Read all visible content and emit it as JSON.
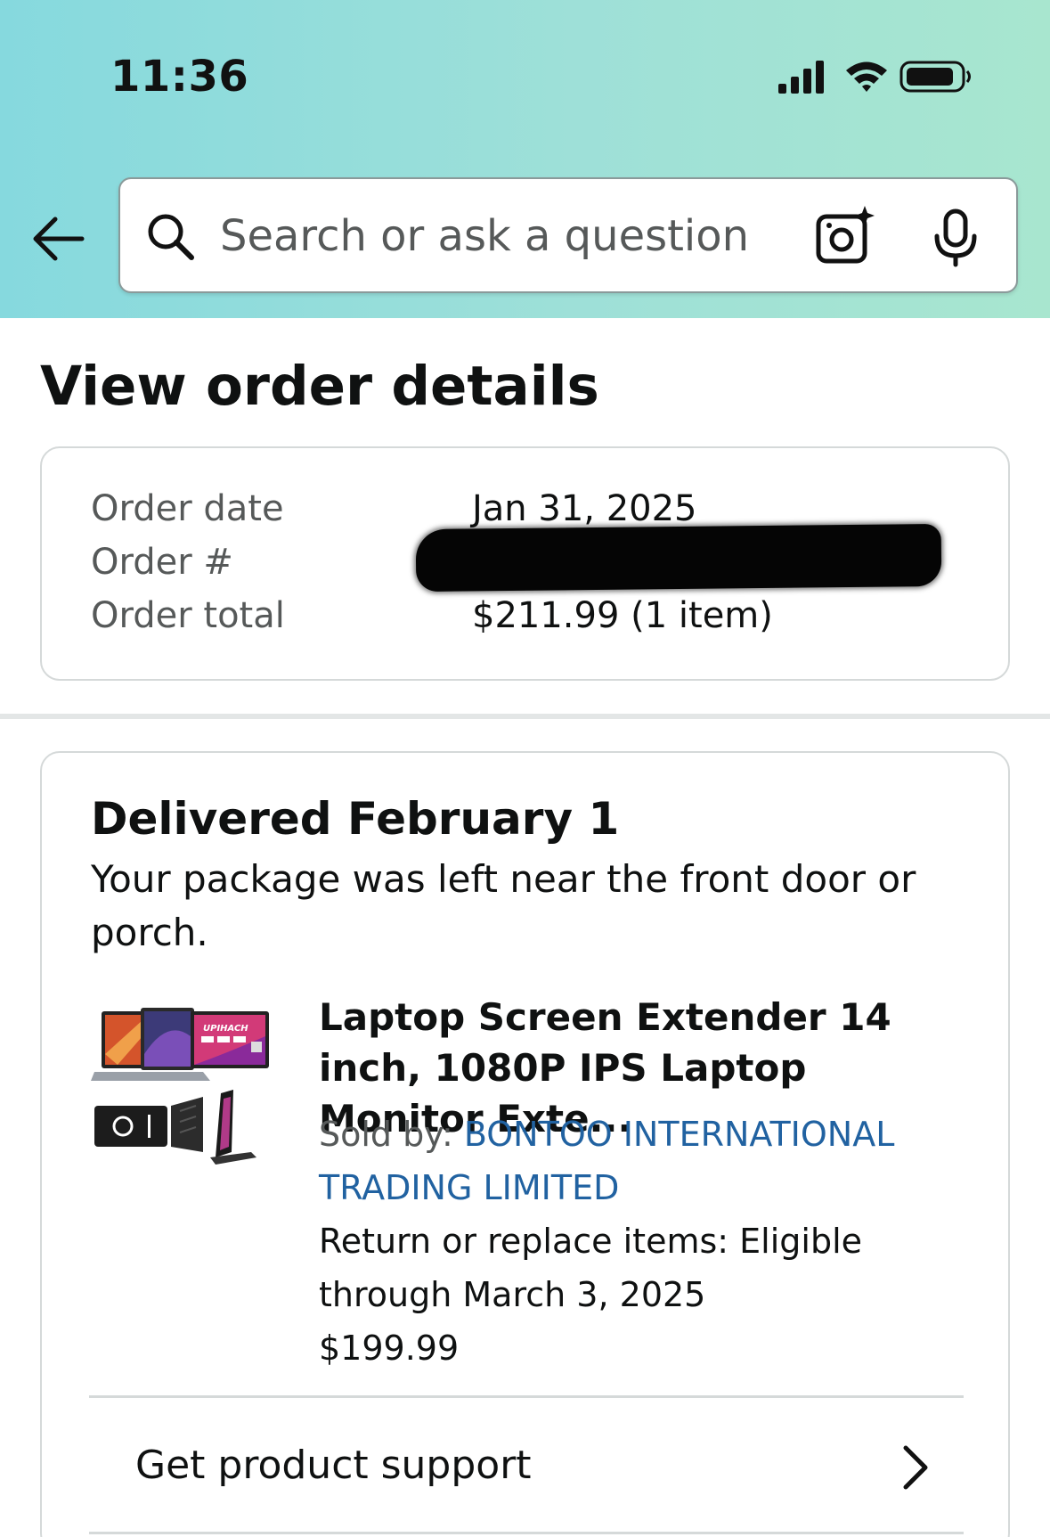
{
  "status_bar": {
    "time": "11:36",
    "icons": [
      "cellular-signal-icon",
      "wifi-icon",
      "battery-icon"
    ]
  },
  "header": {
    "back_icon": "arrow-left-icon",
    "search": {
      "placeholder": "Search or ask a question",
      "value": "",
      "icons": [
        "search-icon",
        "camera-lens-icon",
        "microphone-icon"
      ]
    },
    "background_colors": [
      "#86d9de",
      "#a8e6cf"
    ]
  },
  "page": {
    "title": "View order details"
  },
  "order_summary": {
    "rows": [
      {
        "label": "Order date",
        "value": "Jan 31, 2025"
      },
      {
        "label": "Order #",
        "value": "",
        "redacted": true
      },
      {
        "label": "Order total",
        "value": "$211.99 (1 item)"
      }
    ]
  },
  "shipment": {
    "status_title": "Delivered February 1",
    "status_message": "Your package was left near the front door or porch.",
    "item": {
      "title": "Laptop Screen Extender 14 inch, 1080P IPS Laptop Monitor Exte...",
      "sold_by_label": "Sold by:",
      "seller": "BONTOO INTERNATIONAL TRADING LIMITED",
      "return_text": "Return or replace items: Eligible through March 3, 2025",
      "price": "$199.99",
      "image_brand_text": "UPIHACH"
    },
    "actions": [
      {
        "label": "Get product support",
        "icon": "chevron-right-icon"
      }
    ]
  },
  "colors": {
    "link": "#2162a1",
    "secondary_text": "#565959",
    "border": "#d5d9d9"
  }
}
